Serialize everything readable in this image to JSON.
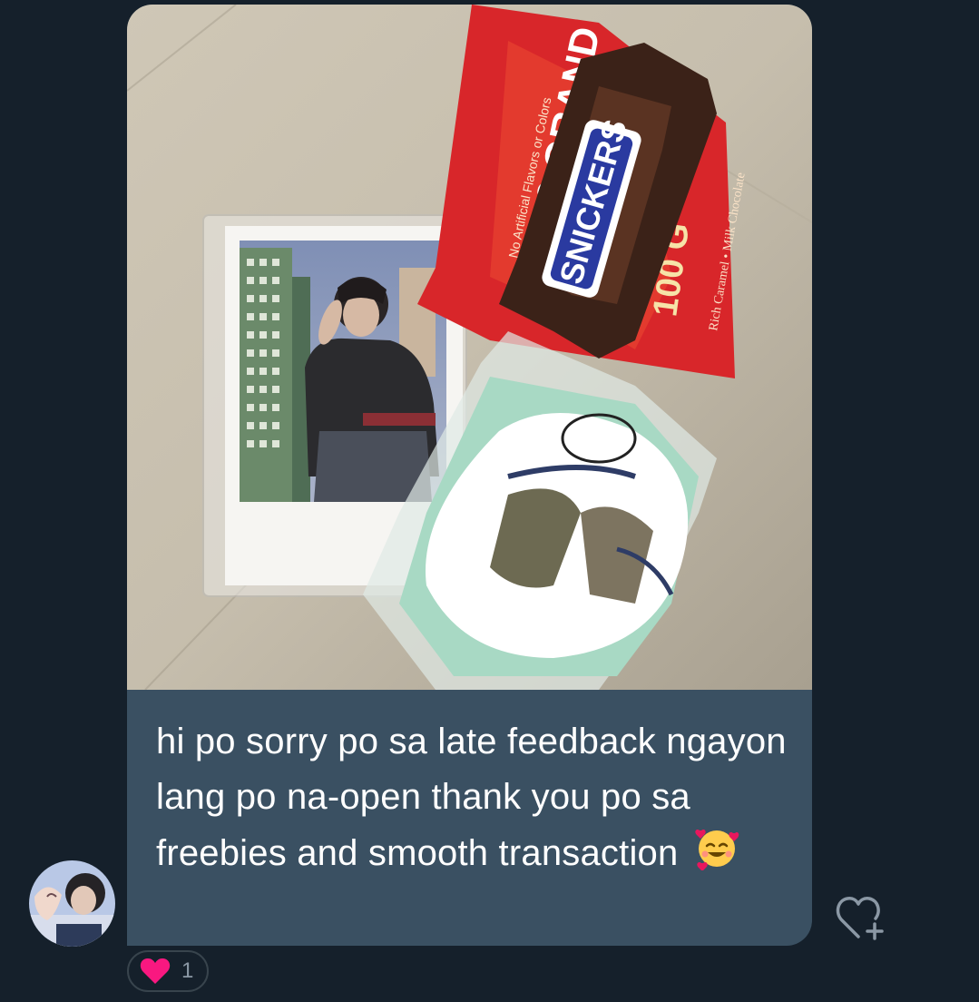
{
  "message": {
    "text": "hi po sorry po sa late feedback ngayon lang po na-open thank you po sa freebies and smooth transaction",
    "emoji": "smiling-face-with-hearts"
  },
  "photo": {
    "candy_wrapper_1": "100 GRAND",
    "candy_wrapper_2": "SNICKERS",
    "candy_caption_1": "No Artificial Flavors or Colors",
    "candy_caption_2": "Rich Caramel • Milk Chocolate"
  },
  "reaction": {
    "icon": "heart-icon",
    "count": "1"
  },
  "colors": {
    "background": "#15202b",
    "bubble": "#3a5062",
    "text": "#ffffff",
    "heart": "#f91880",
    "muted": "#8b98a5"
  }
}
